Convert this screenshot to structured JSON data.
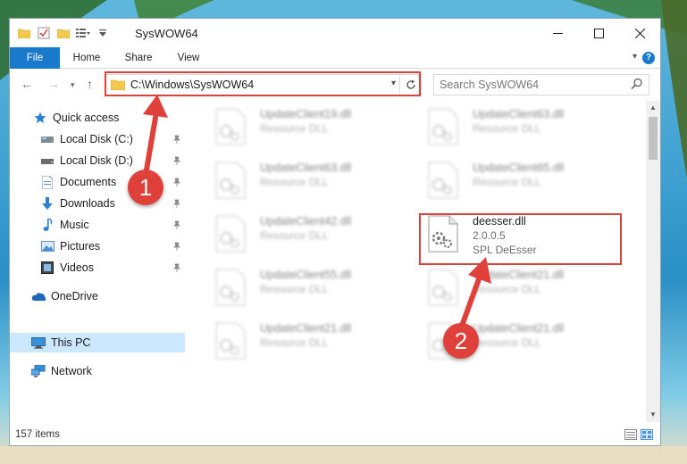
{
  "window": {
    "title": "SysWOW64",
    "controls": {
      "minimize": "—",
      "maximize": "☐",
      "close": "✕"
    }
  },
  "ribbon": {
    "tabs": [
      {
        "label": "File"
      },
      {
        "label": "Home"
      },
      {
        "label": "Share"
      },
      {
        "label": "View"
      }
    ],
    "help": "?"
  },
  "navigation": {
    "address_path": "C:\\Windows\\SysWOW64",
    "search_placeholder": "Search SysWOW64"
  },
  "sidebar": {
    "items": [
      {
        "label": "Quick access",
        "icon": "star-icon",
        "pinned": false
      },
      {
        "label": "Local Disk (C:)",
        "icon": "drive-icon",
        "pinned": true
      },
      {
        "label": "Local Disk (D:)",
        "icon": "drive-icon",
        "pinned": true
      },
      {
        "label": "Documents",
        "icon": "document-icon",
        "pinned": true
      },
      {
        "label": "Downloads",
        "icon": "download-icon",
        "pinned": true
      },
      {
        "label": "Music",
        "icon": "music-icon",
        "pinned": true
      },
      {
        "label": "Pictures",
        "icon": "pictures-icon",
        "pinned": true
      },
      {
        "label": "Videos",
        "icon": "videos-icon",
        "pinned": true
      },
      {
        "label": "OneDrive",
        "icon": "cloud-icon",
        "pinned": false
      },
      {
        "label": "This PC",
        "icon": "computer-icon",
        "pinned": false,
        "selected": true
      },
      {
        "label": "Network",
        "icon": "network-icon",
        "pinned": false
      }
    ]
  },
  "files": [
    {
      "name": "UpdateClient19.dll",
      "line2": "Resource DLL",
      "line3": "",
      "blurred": true
    },
    {
      "name": "UpdateClient63.dll",
      "line2": "Resource DLL",
      "line3": "",
      "blurred": true
    },
    {
      "name": "UpdateClient63.dll",
      "line2": "Resource DLL",
      "line3": "",
      "blurred": true
    },
    {
      "name": "UpdateClient65.dll",
      "line2": "Resource DLL",
      "line3": "",
      "blurred": true
    },
    {
      "name": "UpdateClient42.dll",
      "line2": "Resource DLL",
      "line3": "",
      "blurred": true
    },
    {
      "name": "deesser.dll",
      "line2": "2.0.0.5",
      "line3": "SPL DeEsser",
      "blurred": false
    },
    {
      "name": "UpdateClient55.dll",
      "line2": "Resource DLL",
      "line3": "",
      "blurred": true
    },
    {
      "name": "UpdateClient21.dll",
      "line2": "Resource DLL",
      "line3": "",
      "blurred": true
    },
    {
      "name": "UpdateClient21.dll",
      "line2": "Resource DLL",
      "line3": "",
      "blurred": true
    },
    {
      "name": "UpdateClient21.dll",
      "line2": "Resource DLL",
      "line3": "",
      "blurred": true
    }
  ],
  "status": {
    "item_count": "157 items"
  },
  "annotations": {
    "step1": "1",
    "step2": "2",
    "color": "#e0403a"
  }
}
